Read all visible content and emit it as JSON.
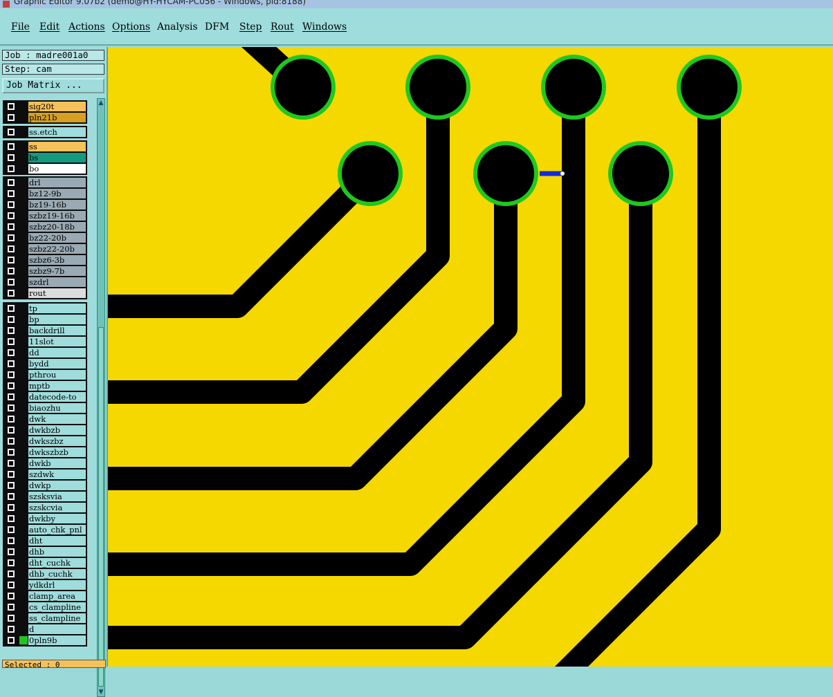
{
  "window": {
    "title": "Graphic Editor 9.07b2 (demo@HY-HYCAM-PC056 - Windows, pid:8188)"
  },
  "menu": [
    {
      "label": "File",
      "underline": true
    },
    {
      "label": "Edit",
      "underline": true
    },
    {
      "label": "Actions",
      "underline": true
    },
    {
      "label": "Options",
      "underline": true
    },
    {
      "label": "Analysis",
      "underline": false
    },
    {
      "label": "DFM",
      "underline": false
    },
    {
      "label": "Step",
      "underline": true
    },
    {
      "label": "Rout",
      "underline": true
    },
    {
      "label": "Windows",
      "underline": true
    }
  ],
  "sidebar": {
    "job_label": "Job : madre001a0",
    "step_label": "Step: cam",
    "job_matrix_button": "Job Matrix ...",
    "selected_label": "Selected : 0",
    "layer_groups": [
      {
        "layers": [
          {
            "name": "sig20t",
            "color": "#f5c15a"
          },
          {
            "name": "pln21b",
            "color": "#d8a020"
          }
        ]
      },
      {
        "layers": [
          {
            "name": "ss.etch",
            "color": "#9fdcdc"
          }
        ]
      },
      {
        "layers": [
          {
            "name": "ss",
            "color": "#f5c15a"
          },
          {
            "name": "bs",
            "color": "#159a80"
          },
          {
            "name": "bo",
            "color": "#ffffff"
          }
        ]
      },
      {
        "layers": [
          {
            "name": "drl",
            "color": "#9aaab4"
          },
          {
            "name": "bz12-9b",
            "color": "#9aaab4"
          },
          {
            "name": "bz19-16b",
            "color": "#9aaab4"
          },
          {
            "name": "szbz19-16b",
            "color": "#9aaab4"
          },
          {
            "name": "szbz20-18b",
            "color": "#9aaab4"
          },
          {
            "name": "bz22-20b",
            "color": "#9aaab4"
          },
          {
            "name": "szbz22-20b",
            "color": "#9aaab4"
          },
          {
            "name": "szbz6-3b",
            "color": "#9aaab4"
          },
          {
            "name": "szbz9-7b",
            "color": "#9aaab4"
          },
          {
            "name": "szdrl",
            "color": "#9aaab4"
          },
          {
            "name": "rout",
            "color": "#dcdcdc"
          }
        ]
      },
      {
        "layers": [
          {
            "name": "tp",
            "color": "#9fdcdc"
          },
          {
            "name": "bp",
            "color": "#9fdcdc"
          },
          {
            "name": "backdrill",
            "color": "#9fdcdc"
          },
          {
            "name": "11slot",
            "color": "#9fdcdc"
          },
          {
            "name": "dd",
            "color": "#9fdcdc"
          },
          {
            "name": "bydd",
            "color": "#9fdcdc"
          },
          {
            "name": "pthrou",
            "color": "#9fdcdc"
          },
          {
            "name": "mptb",
            "color": "#9fdcdc"
          },
          {
            "name": "datecode-to",
            "color": "#9fdcdc"
          },
          {
            "name": "biaozhu",
            "color": "#9fdcdc"
          },
          {
            "name": "dwk",
            "color": "#9fdcdc"
          },
          {
            "name": "dwkbzb",
            "color": "#9fdcdc"
          },
          {
            "name": "dwkszbz",
            "color": "#9fdcdc"
          },
          {
            "name": "dwkszbzb",
            "color": "#9fdcdc"
          },
          {
            "name": "dwkb",
            "color": "#9fdcdc"
          },
          {
            "name": "szdwk",
            "color": "#9fdcdc"
          },
          {
            "name": "dwkp",
            "color": "#9fdcdc"
          },
          {
            "name": "szsksvia",
            "color": "#9fdcdc"
          },
          {
            "name": "szskcvia",
            "color": "#9fdcdc"
          },
          {
            "name": "dwkby",
            "color": "#9fdcdc"
          },
          {
            "name": "auto_chk_pnl",
            "color": "#9fdcdc"
          },
          {
            "name": "dht",
            "color": "#9fdcdc"
          },
          {
            "name": "dhb",
            "color": "#9fdcdc"
          },
          {
            "name": "dht_cuchk",
            "color": "#9fdcdc"
          },
          {
            "name": "dhb_cuchk",
            "color": "#9fdcdc"
          },
          {
            "name": "ydkdrl",
            "color": "#9fdcdc"
          },
          {
            "name": "clamp_area",
            "color": "#9fdcdc"
          },
          {
            "name": "cs_clampline",
            "color": "#9fdcdc"
          },
          {
            "name": "ss_clampline",
            "color": "#9fdcdc"
          },
          {
            "name": "d",
            "color": "#9fdcdc"
          },
          {
            "name": "0pln9b",
            "color": "#9fdcdc",
            "swatch": "#22c422"
          }
        ]
      }
    ]
  },
  "canvas": {
    "background_color": "#f5d800",
    "trace_color": "#000000",
    "pad_ring_color": "#1ec81e",
    "highlight_color": "#1428e0"
  }
}
